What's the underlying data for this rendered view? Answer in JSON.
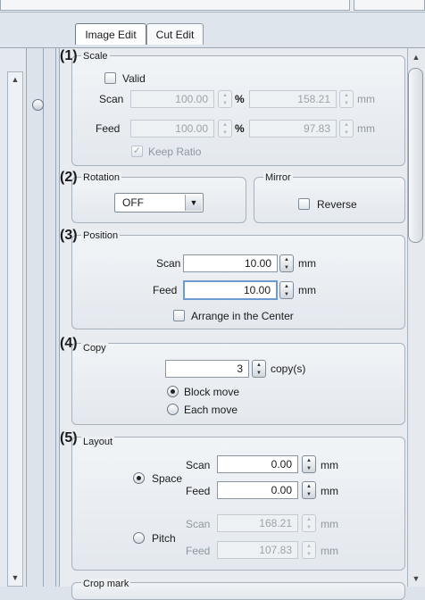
{
  "tabs": [
    "Image Edit",
    "Cut Edit"
  ],
  "scale": {
    "num": "(1)",
    "title": "Scale",
    "valid_label": "Valid",
    "scan_label": "Scan",
    "feed_label": "Feed",
    "scan_pct": "100.00",
    "feed_pct": "100.00",
    "pct_unit": "%",
    "scan_mm": "158.21",
    "feed_mm": "97.83",
    "mm_unit": "mm",
    "keep_ratio": "Keep Ratio"
  },
  "rotation": {
    "num": "(2)",
    "title": "Rotation",
    "value": "OFF"
  },
  "mirror": {
    "title": "Mirror",
    "reverse_label": "Reverse"
  },
  "position": {
    "num": "(3)",
    "title": "Position",
    "scan_label": "Scan",
    "feed_label": "Feed",
    "scan_value": "10.00",
    "feed_value": "10.00",
    "unit": "mm",
    "arrange_label": "Arrange in the Center"
  },
  "copy": {
    "num": "(4)",
    "title": "Copy",
    "value": "3",
    "unit": "copy(s)",
    "block_move": "Block move",
    "each_move": "Each move"
  },
  "layout": {
    "num": "(5)",
    "title": "Layout",
    "space_label": "Space",
    "pitch_label": "Pitch",
    "scan_label": "Scan",
    "feed_label": "Feed",
    "space_scan": "0.00",
    "space_feed": "0.00",
    "pitch_scan": "168.21",
    "pitch_feed": "107.83",
    "unit": "mm"
  },
  "crop": {
    "title": "Crop mark"
  }
}
